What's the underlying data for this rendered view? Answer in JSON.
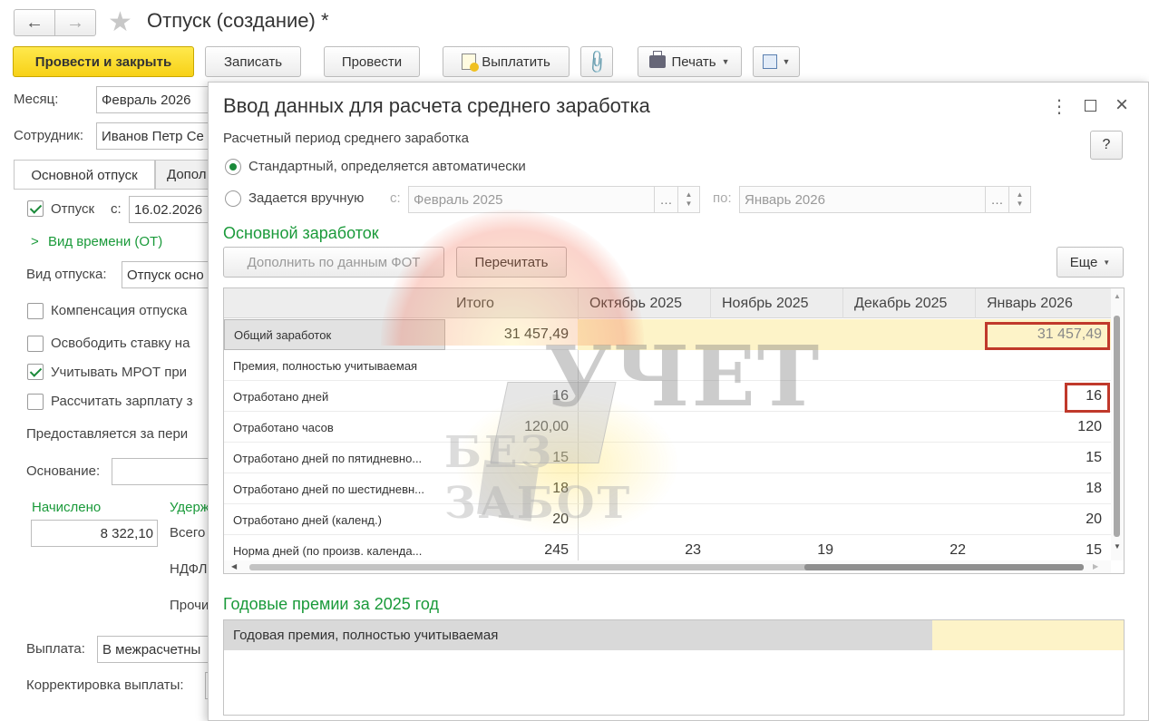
{
  "window": {
    "title": "Отпуск (создание) *"
  },
  "toolbar": {
    "post_close": "Провести и закрыть",
    "save": "Записать",
    "post": "Провести",
    "pay": "Выплатить",
    "print": "Печать"
  },
  "form": {
    "month_label": "Месяц:",
    "month_value": "Февраль 2026",
    "employee_label": "Сотрудник:",
    "employee_value": "Иванов Петр Се",
    "tabs": [
      "Основной отпуск",
      "Допол"
    ],
    "vacation_label": "Отпуск",
    "vacation_from_label": "с:",
    "vacation_from_value": "16.02.2026",
    "time_type": "Вид времени (ОТ)",
    "vacation_type_label": "Вид отпуска:",
    "vacation_type_value": "Отпуск осно",
    "compensation_label": "Компенсация отпуска",
    "free_rate_label": "Освободить ставку на",
    "mrot_label": "Учитывать МРОТ при",
    "calc_salary_label": "Рассчитать зарплату з",
    "provided_label": "Предоставляется за пери",
    "basis_label": "Основание:",
    "accrued_label": "Начислено",
    "withheld_label": "Удерж",
    "accrued_value": "8 322,10",
    "total_label": "Всего",
    "ndfl_label": "НДФЛ",
    "other_label": "Прочи",
    "payment_label": "Выплата:",
    "payment_value": "В межрасчетны",
    "adjust_label": "Корректировка выплаты:"
  },
  "dialog": {
    "title": "Ввод данных для расчета среднего заработка",
    "help": "?",
    "period_label": "Расчетный период среднего заработка",
    "radio_standard": "Стандартный, определяется автоматически",
    "radio_manual": "Задается вручную",
    "from_label": "с:",
    "from_value": "Февраль 2025",
    "to_label": "по:",
    "to_value": "Январь 2026",
    "section_main": "Основной заработок",
    "btn_fill": "Дополнить по данным ФОТ",
    "btn_recalc": "Перечитать",
    "btn_more": "Еще",
    "columns": [
      "Итого",
      "Октябрь 2025",
      "Ноябрь 2025",
      "Декабрь 2025",
      "Январь 2026"
    ],
    "rows": [
      {
        "name": "Общий заработок",
        "total": "31 457,49",
        "oct": "",
        "nov": "",
        "dec": "",
        "jan": "31 457,49"
      },
      {
        "name": "Премия, полностью учитываемая",
        "total": "",
        "oct": "",
        "nov": "",
        "dec": "",
        "jan": ""
      },
      {
        "name": "Отработано дней",
        "total": "16",
        "oct": "",
        "nov": "",
        "dec": "",
        "jan": "16"
      },
      {
        "name": "Отработано часов",
        "total": "120,00",
        "oct": "",
        "nov": "",
        "dec": "",
        "jan": "120"
      },
      {
        "name": "Отработано дней по пятидневно...",
        "total": "15",
        "oct": "",
        "nov": "",
        "dec": "",
        "jan": "15"
      },
      {
        "name": "Отработано дней по шестидневн...",
        "total": "18",
        "oct": "",
        "nov": "",
        "dec": "",
        "jan": "18"
      },
      {
        "name": "Отработано дней (календ.)",
        "total": "20",
        "oct": "",
        "nov": "",
        "dec": "",
        "jan": "20"
      },
      {
        "name": "Норма дней (по произв. календа...",
        "total": "245",
        "oct": "23",
        "nov": "19",
        "dec": "22",
        "jan": "15"
      }
    ],
    "section_bonus": "Годовые премии за 2025 год",
    "bonus_row": "Годовая премия, полностью учитываемая"
  },
  "watermark": {
    "line1": "УЧЕТ",
    "line2": "БЕЗ ЗАБОТ"
  },
  "colors": {
    "accent_green": "#1a9a3a",
    "highlight": "#fdf3c8",
    "primary_button": "#f7d117",
    "red_box": "#c0392b"
  }
}
